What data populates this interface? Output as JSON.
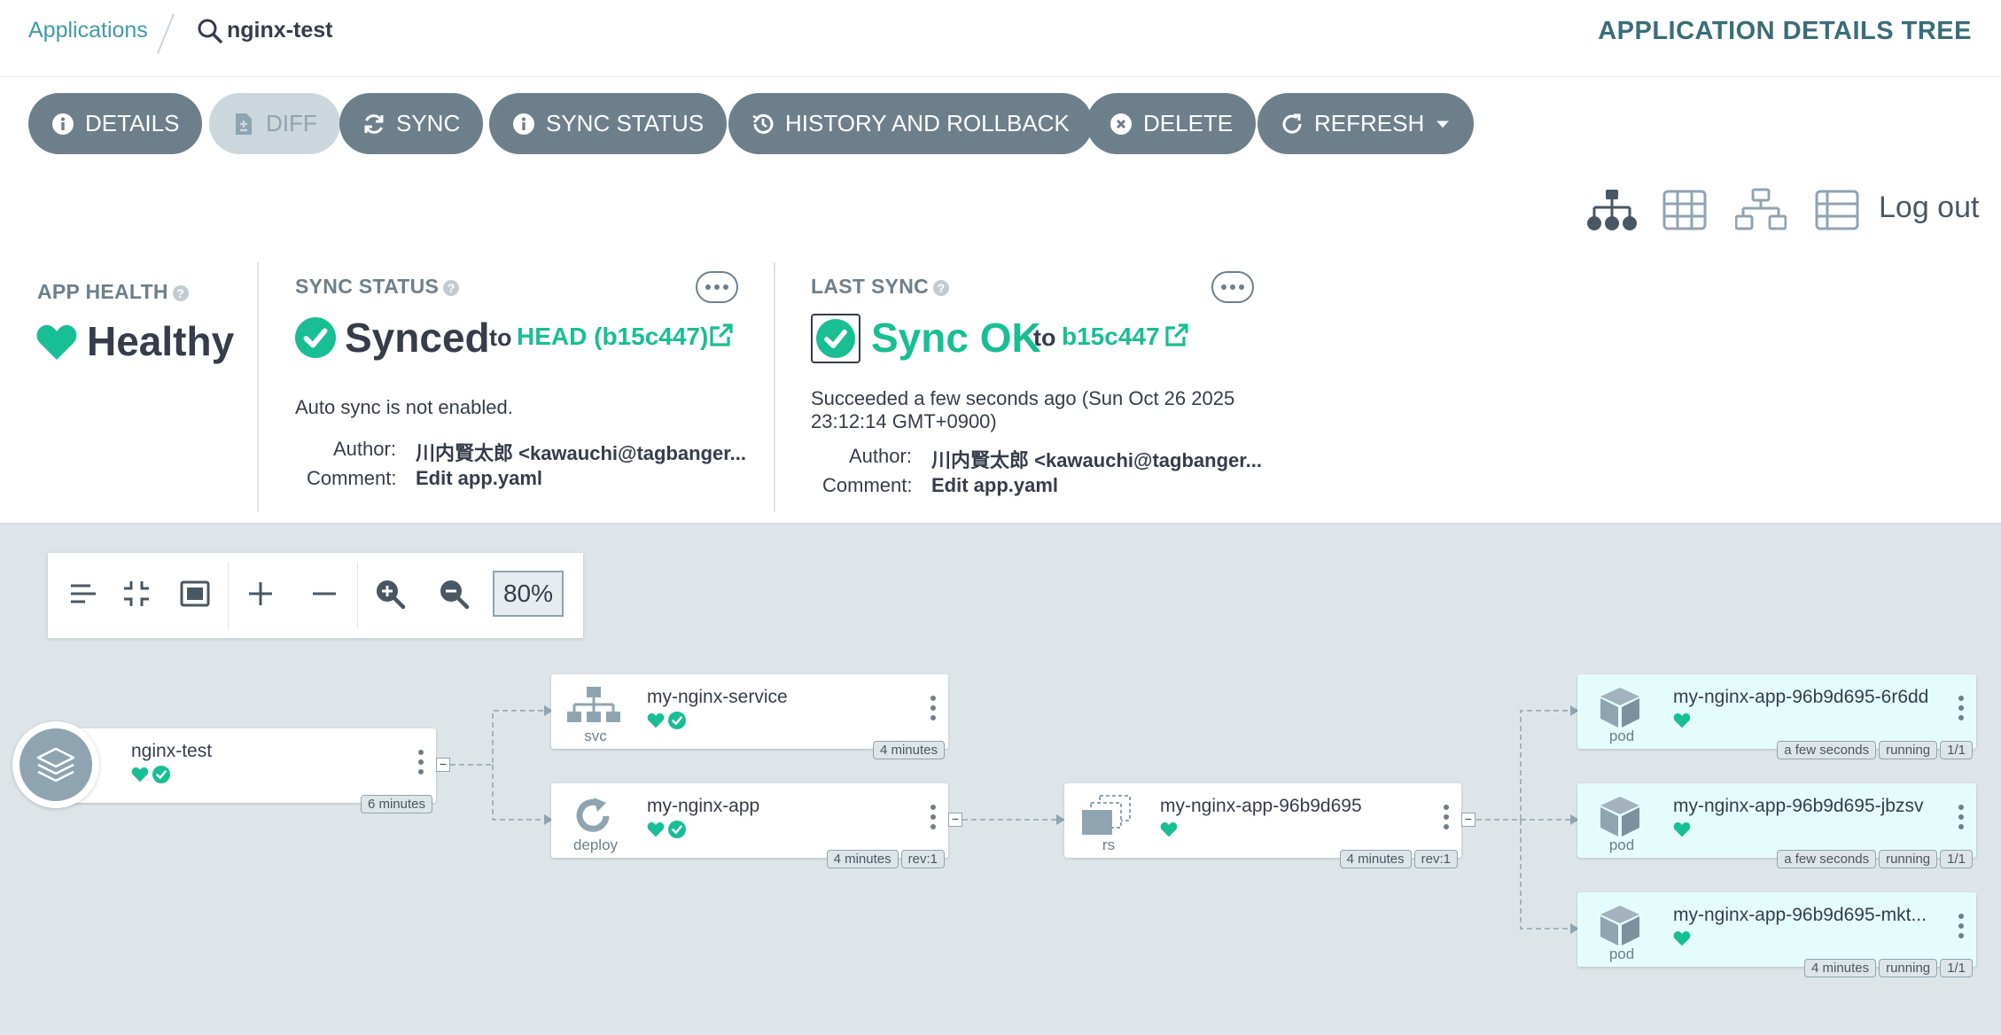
{
  "breadcrumb": {
    "applications": "Applications",
    "current": "nginx-test"
  },
  "page_title": "APPLICATION DETAILS TREE",
  "toolbar": {
    "details": "DETAILS",
    "diff": "DIFF",
    "sync": "SYNC",
    "sync_status": "SYNC STATUS",
    "history": "HISTORY AND ROLLBACK",
    "delete": "DELETE",
    "refresh": "REFRESH"
  },
  "views": {
    "logout": "Log out"
  },
  "app_health": {
    "label": "APP HEALTH",
    "value": "Healthy"
  },
  "sync_status": {
    "label": "SYNC STATUS",
    "value": "Synced",
    "to": "to",
    "revision": "HEAD (b15c447)",
    "auto_sync": "Auto sync is not enabled.",
    "author_label": "Author:",
    "author_value": "川内賢太郎 <kawauchi@tagbanger...",
    "comment_label": "Comment:",
    "comment_value": "Edit app.yaml"
  },
  "last_sync": {
    "label": "LAST SYNC",
    "value": "Sync OK",
    "to": "to",
    "revision": "b15c447",
    "succeeded_line1": "Succeeded a few seconds ago (Sun Oct 26 2025",
    "succeeded_line2": "23:12:14 GMT+0900)",
    "author_label": "Author:",
    "author_value": "川内賢太郎 <kawauchi@tagbanger...",
    "comment_label": "Comment:",
    "comment_value": "Edit app.yaml"
  },
  "zoom": {
    "value": "80%"
  },
  "colors": {
    "healthy": "#18be94",
    "toolbar": "#6d7f8b",
    "pod_bg": "#e4fdfc",
    "graph_bg": "#dee5e9"
  },
  "nodes": {
    "root": {
      "name": "nginx-test",
      "age": "6 minutes"
    },
    "svc": {
      "name": "my-nginx-service",
      "kind": "svc",
      "age": "4 minutes"
    },
    "deploy": {
      "name": "my-nginx-app",
      "kind": "deploy",
      "age": "4 minutes",
      "rev": "rev:1"
    },
    "rs": {
      "name": "my-nginx-app-96b9d695",
      "kind": "rs",
      "age": "4 minutes",
      "rev": "rev:1"
    },
    "pod1": {
      "name": "my-nginx-app-96b9d695-6r6dd",
      "kind": "pod",
      "age": "a few seconds",
      "status": "running",
      "ready": "1/1"
    },
    "pod2": {
      "name": "my-nginx-app-96b9d695-jbzsv",
      "kind": "pod",
      "age": "a few seconds",
      "status": "running",
      "ready": "1/1"
    },
    "pod3": {
      "name": "my-nginx-app-96b9d695-mkt...",
      "kind": "pod",
      "age": "4 minutes",
      "status": "running",
      "ready": "1/1"
    }
  }
}
